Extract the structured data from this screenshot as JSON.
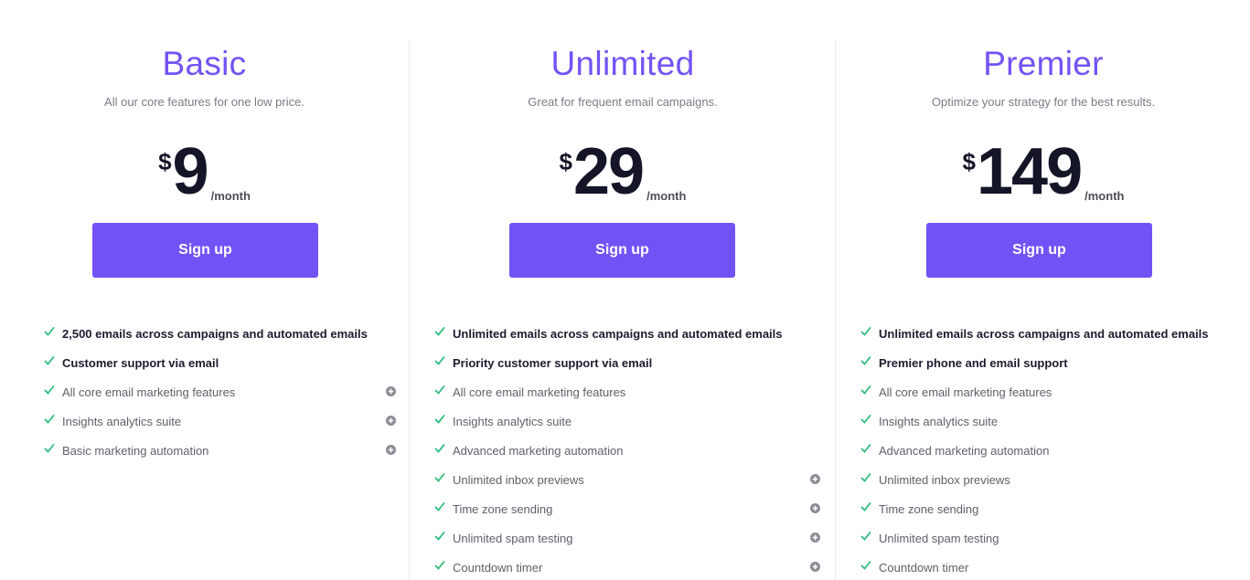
{
  "colors": {
    "accent": "#7352f5",
    "check": "#2ebd7a",
    "price_text": "#151528",
    "muted_text": "#7b7b86",
    "plus_icon": "#8c8c96"
  },
  "plans": [
    {
      "name": "Basic",
      "tagline": "All our core features for one low price.",
      "currency": "$",
      "amount": "9",
      "period": "/month",
      "button": "Sign up",
      "features": [
        {
          "label": "2,500 emails across campaigns and automated emails",
          "bold": true,
          "icon": "check-icon",
          "expand": false
        },
        {
          "label": "Customer support via email",
          "bold": true,
          "icon": "check-icon",
          "expand": false
        },
        {
          "label": "All core email marketing features",
          "bold": false,
          "icon": "check-icon",
          "expand": true
        },
        {
          "label": "Insights analytics suite",
          "bold": false,
          "icon": "check-icon",
          "expand": true
        },
        {
          "label": "Basic marketing automation",
          "bold": false,
          "icon": "check-icon",
          "expand": true
        }
      ]
    },
    {
      "name": "Unlimited",
      "tagline": "Great for frequent email campaigns.",
      "currency": "$",
      "amount": "29",
      "period": "/month",
      "button": "Sign up",
      "features": [
        {
          "label": "Unlimited emails across campaigns and automated emails",
          "bold": true,
          "icon": "check-icon",
          "expand": false
        },
        {
          "label": "Priority customer support via email",
          "bold": true,
          "icon": "check-icon",
          "expand": false
        },
        {
          "label": "All core email marketing features",
          "bold": false,
          "icon": "check-icon",
          "expand": false
        },
        {
          "label": "Insights analytics suite",
          "bold": false,
          "icon": "check-icon",
          "expand": false
        },
        {
          "label": "Advanced marketing automation",
          "bold": false,
          "icon": "check-icon",
          "expand": false
        },
        {
          "label": "Unlimited inbox previews",
          "bold": false,
          "icon": "check-icon",
          "expand": true
        },
        {
          "label": "Time zone sending",
          "bold": false,
          "icon": "check-icon",
          "expand": true
        },
        {
          "label": "Unlimited spam testing",
          "bold": false,
          "icon": "check-icon",
          "expand": true
        },
        {
          "label": "Countdown timer",
          "bold": false,
          "icon": "check-icon",
          "expand": true
        }
      ]
    },
    {
      "name": "Premier",
      "tagline": "Optimize your strategy for the best results.",
      "currency": "$",
      "amount": "149",
      "period": "/month",
      "button": "Sign up",
      "features": [
        {
          "label": "Unlimited emails across campaigns and automated emails",
          "bold": true,
          "icon": "check-icon",
          "expand": false
        },
        {
          "label": "Premier phone and email support",
          "bold": true,
          "icon": "check-icon",
          "expand": false
        },
        {
          "label": "All core email marketing features",
          "bold": false,
          "icon": "check-icon",
          "expand": false
        },
        {
          "label": "Insights analytics suite",
          "bold": false,
          "icon": "check-icon",
          "expand": false
        },
        {
          "label": "Advanced marketing automation",
          "bold": false,
          "icon": "check-icon",
          "expand": false
        },
        {
          "label": "Unlimited inbox previews",
          "bold": false,
          "icon": "check-icon",
          "expand": false
        },
        {
          "label": "Time zone sending",
          "bold": false,
          "icon": "check-icon",
          "expand": false
        },
        {
          "label": "Unlimited spam testing",
          "bold": false,
          "icon": "check-icon",
          "expand": false
        },
        {
          "label": "Countdown timer",
          "bold": false,
          "icon": "check-icon",
          "expand": false
        }
      ]
    }
  ]
}
